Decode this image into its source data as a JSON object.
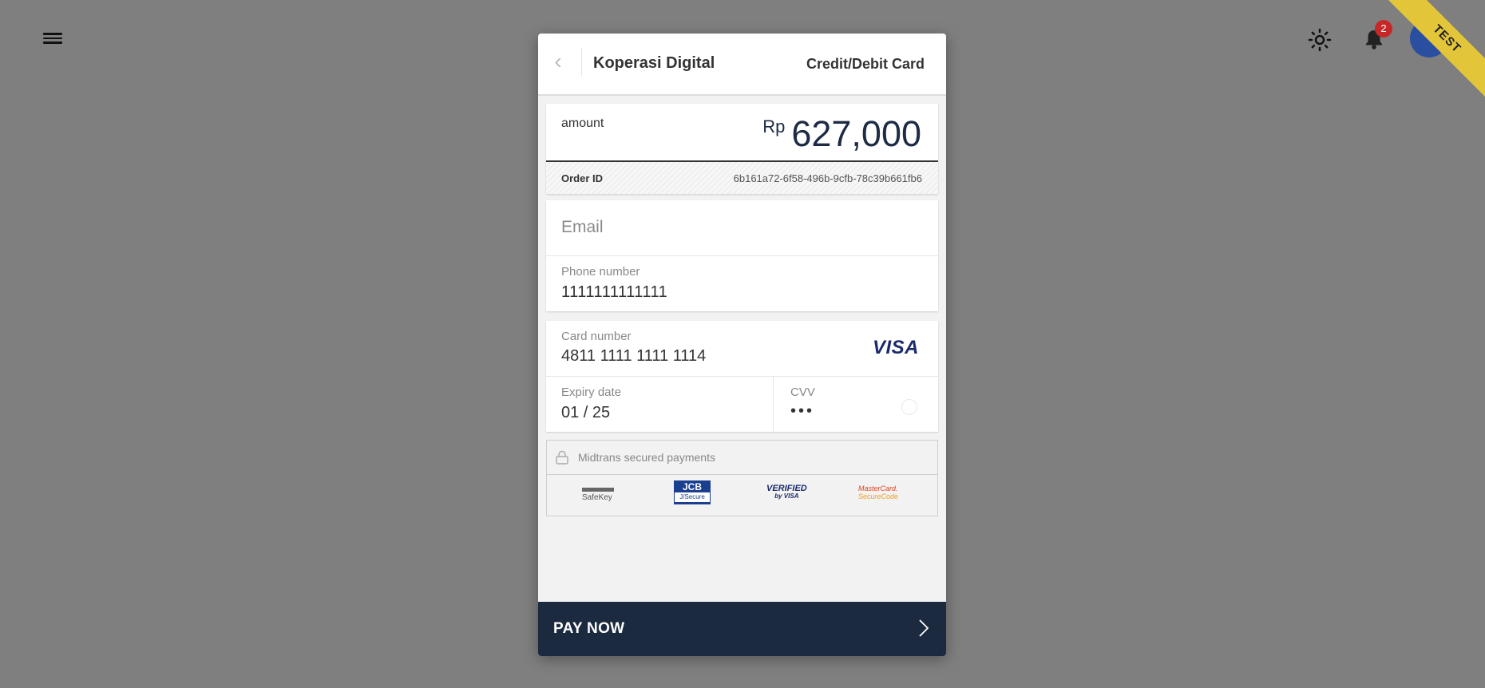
{
  "topbar": {
    "menu_icon": "hamburger-icon",
    "theme_icon": "sun-icon",
    "notifications_icon": "bell-icon",
    "notifications_count": "2",
    "environment_badge": "TEST"
  },
  "header": {
    "back_icon": "chevron-left-icon",
    "merchant_name": "Koperasi Digital",
    "payment_method": "Credit/Debit Card"
  },
  "amount": {
    "label": "amount",
    "currency": "Rp",
    "value": "627,000"
  },
  "order": {
    "label": "Order ID",
    "value": "6b161a72-6f58-496b-9cfb-78c39b661fb6"
  },
  "contact": {
    "email_placeholder": "Email",
    "email_value": "",
    "phone_label": "Phone number",
    "phone_value": "1111111111111"
  },
  "card": {
    "number_label": "Card number",
    "number_value": "4811 1111 1111 1114",
    "brand": "VISA",
    "expiry_label": "Expiry date",
    "expiry_value": "01 / 25",
    "cvv_label": "CVV",
    "cvv_value": "•••"
  },
  "security": {
    "lock_icon": "lock-icon",
    "text": "Midtrans secured payments",
    "badges": {
      "safekey": "SafeKey",
      "jcb_top": "JCB",
      "jcb_bottom": "J/Secure",
      "vbv_top": "VERIFIED",
      "vbv_bottom": "by VISA",
      "mc_top": "MasterCard.",
      "mc_bottom": "SecureCode"
    }
  },
  "pay_button": {
    "label": "PAY NOW",
    "icon": "chevron-right-icon"
  },
  "colors": {
    "backdrop": "#7f7f7f",
    "pay_button_bg": "#1b2a3f",
    "amount_text": "#1d2b45",
    "test_ribbon": "#e3c53a",
    "badge_red": "#c62828"
  }
}
